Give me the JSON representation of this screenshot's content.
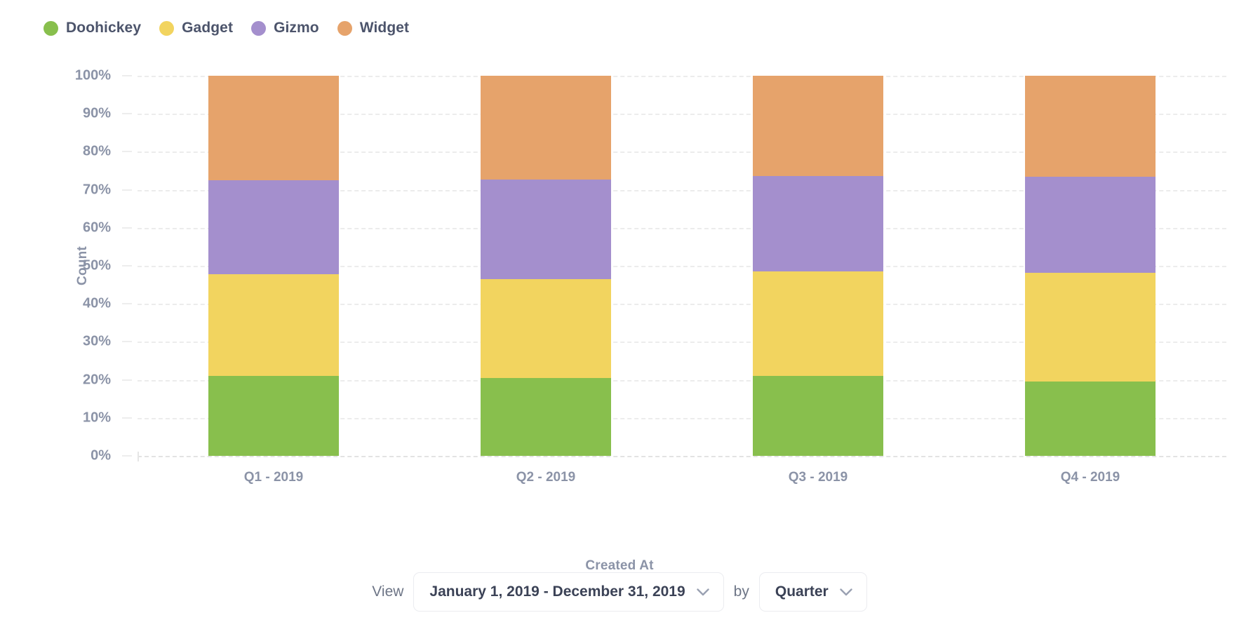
{
  "legend": {
    "items": [
      {
        "label": "Doohickey",
        "color": "#88bf4d"
      },
      {
        "label": "Gadget",
        "color": "#f2d45f"
      },
      {
        "label": "Gizmo",
        "color": "#a48fcd"
      },
      {
        "label": "Widget",
        "color": "#e6a36b"
      }
    ]
  },
  "footer": {
    "view_label": "View",
    "date_range": "January 1, 2019 - December 31, 2019",
    "by_label": "by",
    "granularity": "Quarter",
    "chevron_icon": "chevron-down-icon"
  },
  "chart_data": {
    "type": "bar",
    "stacked": true,
    "normalized": true,
    "title": "",
    "xlabel": "Created At",
    "ylabel": "Count",
    "ylim": [
      0,
      100
    ],
    "ytick_labels": [
      "100%",
      "90%",
      "80%",
      "70%",
      "60%",
      "50%",
      "40%",
      "30%",
      "20%",
      "10%",
      "0%"
    ],
    "ytick_values": [
      100,
      90,
      80,
      70,
      60,
      50,
      40,
      30,
      20,
      10,
      0
    ],
    "grid": true,
    "legend_position": "top-left",
    "categories": [
      "Q1 - 2019",
      "Q2 - 2019",
      "Q3 - 2019",
      "Q4 - 2019"
    ],
    "series": [
      {
        "name": "Doohickey",
        "color": "#88bf4d",
        "values": [
          21.0,
          20.5,
          21.0,
          19.5
        ]
      },
      {
        "name": "Gadget",
        "color": "#f2d45f",
        "values": [
          26.8,
          26.0,
          27.5,
          28.6
        ]
      },
      {
        "name": "Gizmo",
        "color": "#a48fcd",
        "values": [
          24.7,
          26.2,
          25.2,
          25.4
        ]
      },
      {
        "name": "Widget",
        "color": "#e6a36b",
        "values": [
          27.5,
          27.3,
          26.3,
          26.5
        ]
      }
    ]
  }
}
